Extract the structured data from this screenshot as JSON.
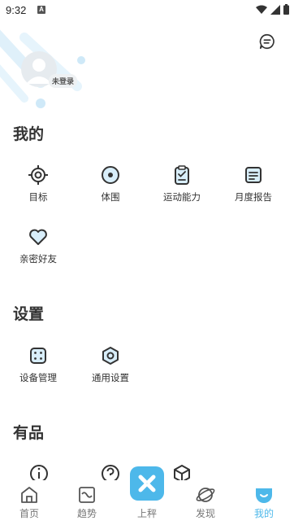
{
  "status_bar": {
    "time": "9:32",
    "notification_letter": "A"
  },
  "profile": {
    "login_badge": "未登录"
  },
  "sections": {
    "mine": {
      "title": "我的",
      "items": [
        {
          "label": "目标",
          "icon": "target-icon"
        },
        {
          "label": "体围",
          "icon": "measure-tape-icon"
        },
        {
          "label": "运动能力",
          "icon": "clipboard-icon"
        },
        {
          "label": "月度报告",
          "icon": "report-icon"
        },
        {
          "label": "亲密好友",
          "icon": "heart-icon"
        }
      ]
    },
    "settings": {
      "title": "设置",
      "items": [
        {
          "label": "设备管理",
          "icon": "device-icon"
        },
        {
          "label": "通用设置",
          "icon": "settings-hex-icon"
        }
      ]
    },
    "goods": {
      "title": "有品"
    }
  },
  "tabbar": {
    "items": [
      {
        "label": "首页",
        "icon": "home-icon"
      },
      {
        "label": "趋势",
        "icon": "trend-icon"
      },
      {
        "label": "上秤",
        "icon": "scale-icon"
      },
      {
        "label": "发现",
        "icon": "planet-icon"
      },
      {
        "label": "我的",
        "icon": "profile-icon",
        "active": true
      }
    ]
  },
  "colors": {
    "accent": "#4db8ea",
    "text": "#333333"
  }
}
